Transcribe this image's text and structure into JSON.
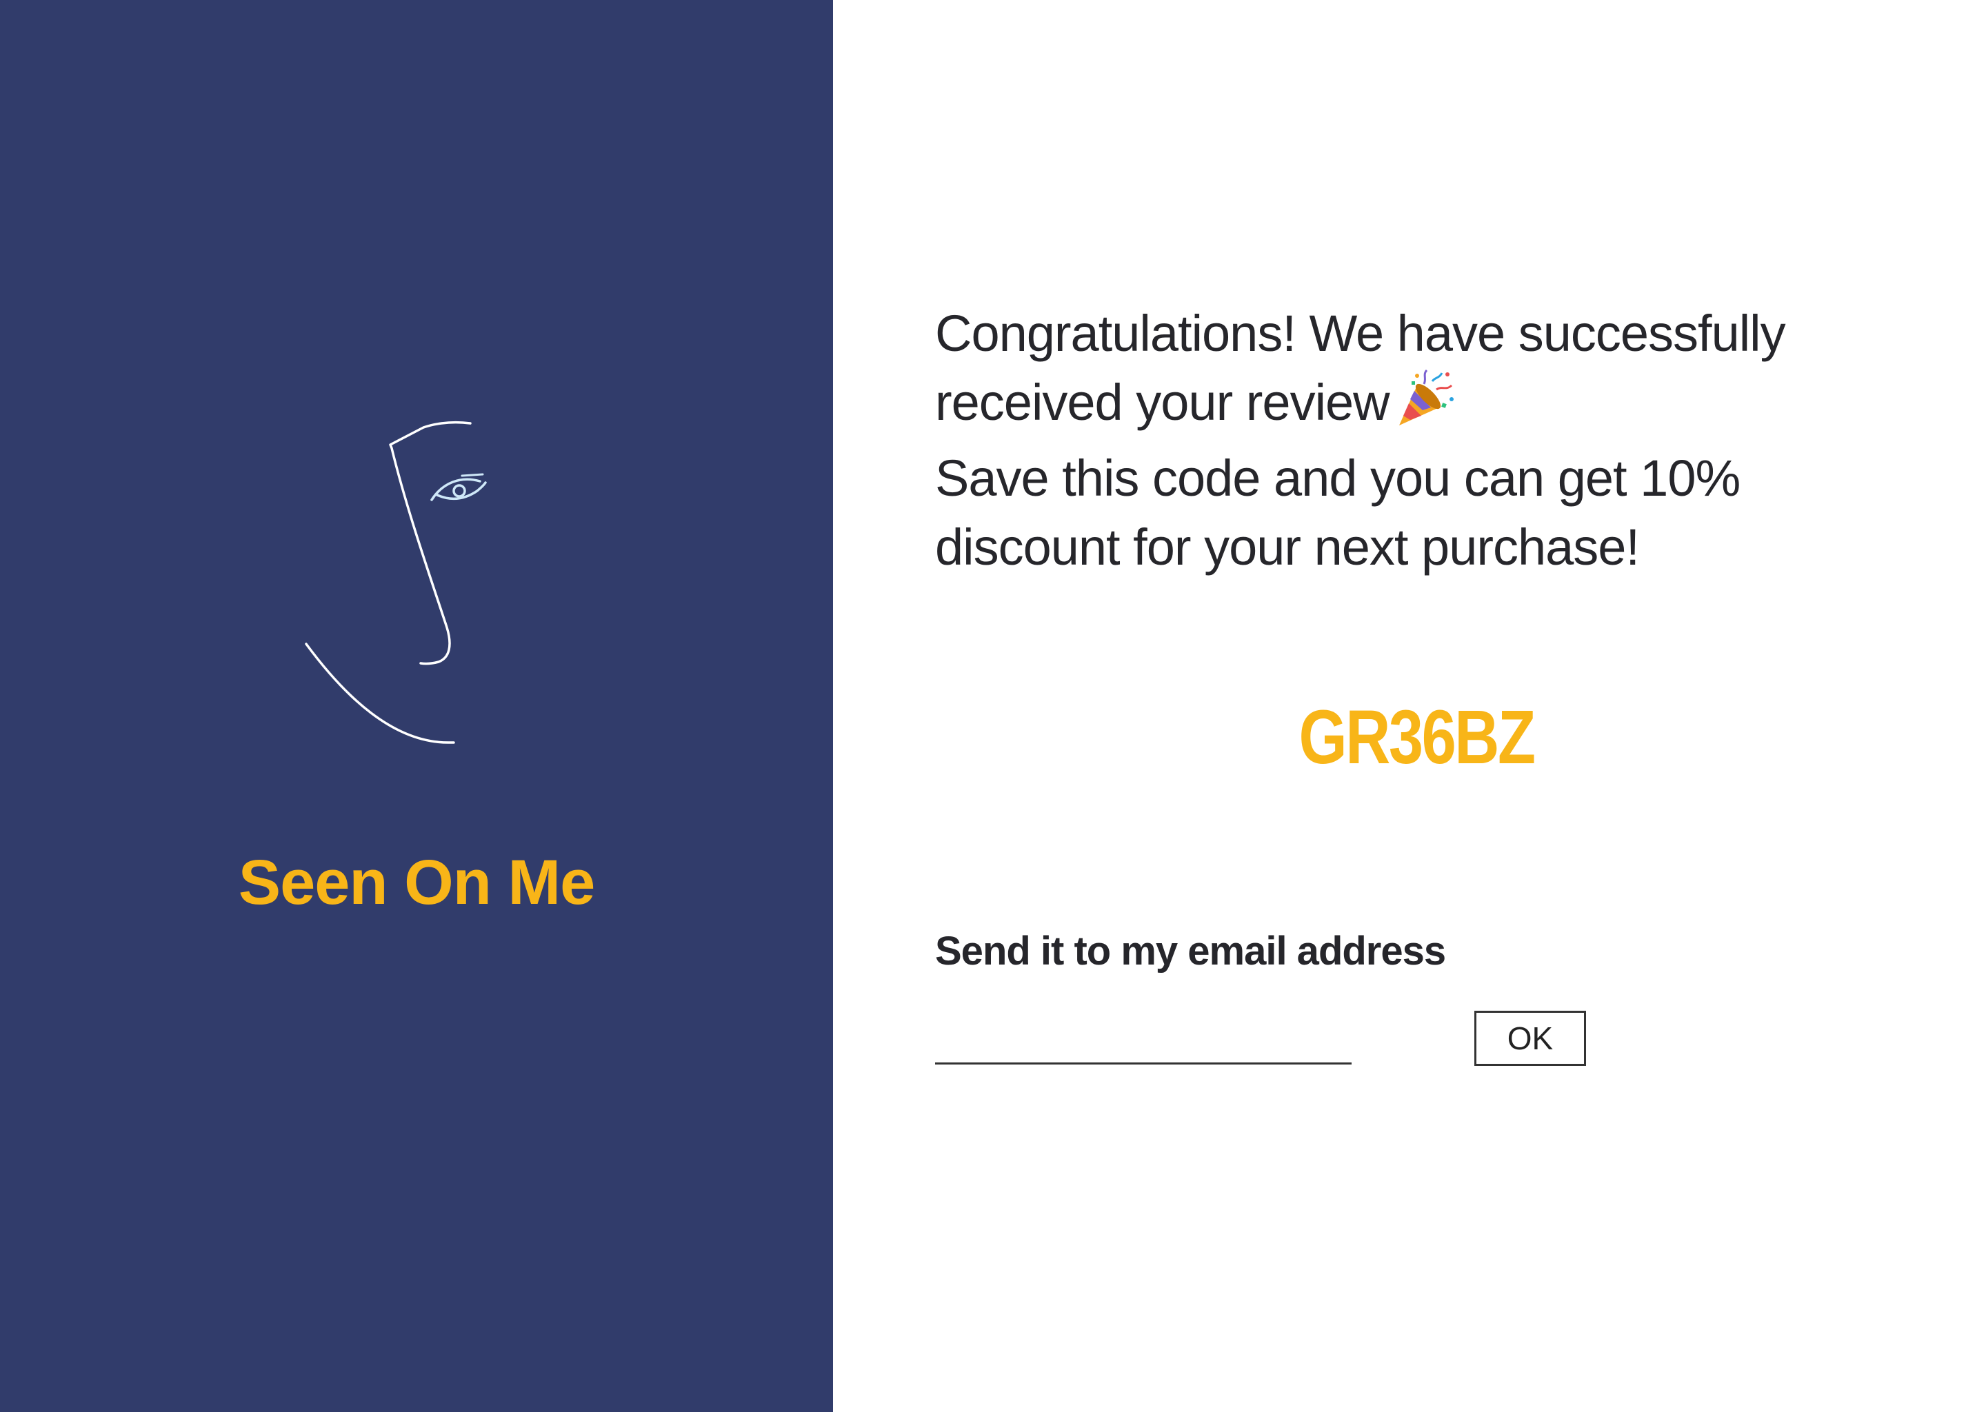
{
  "brand": {
    "name": "Seen On Me",
    "accent_color": "#f8b518",
    "panel_color": "#313c6b",
    "logo_icon": "face-line-art-icon"
  },
  "message": {
    "line1": "Congratulations! We have successfully received your review",
    "line1_emoji_icon": "party-popper-icon",
    "line2": "Save this code and you can get 10% discount for your next purchase!"
  },
  "discount": {
    "code": "GR36BZ"
  },
  "email_form": {
    "label": "Send it to my email address",
    "input_value": "",
    "input_placeholder": "",
    "button_label": "OK"
  }
}
